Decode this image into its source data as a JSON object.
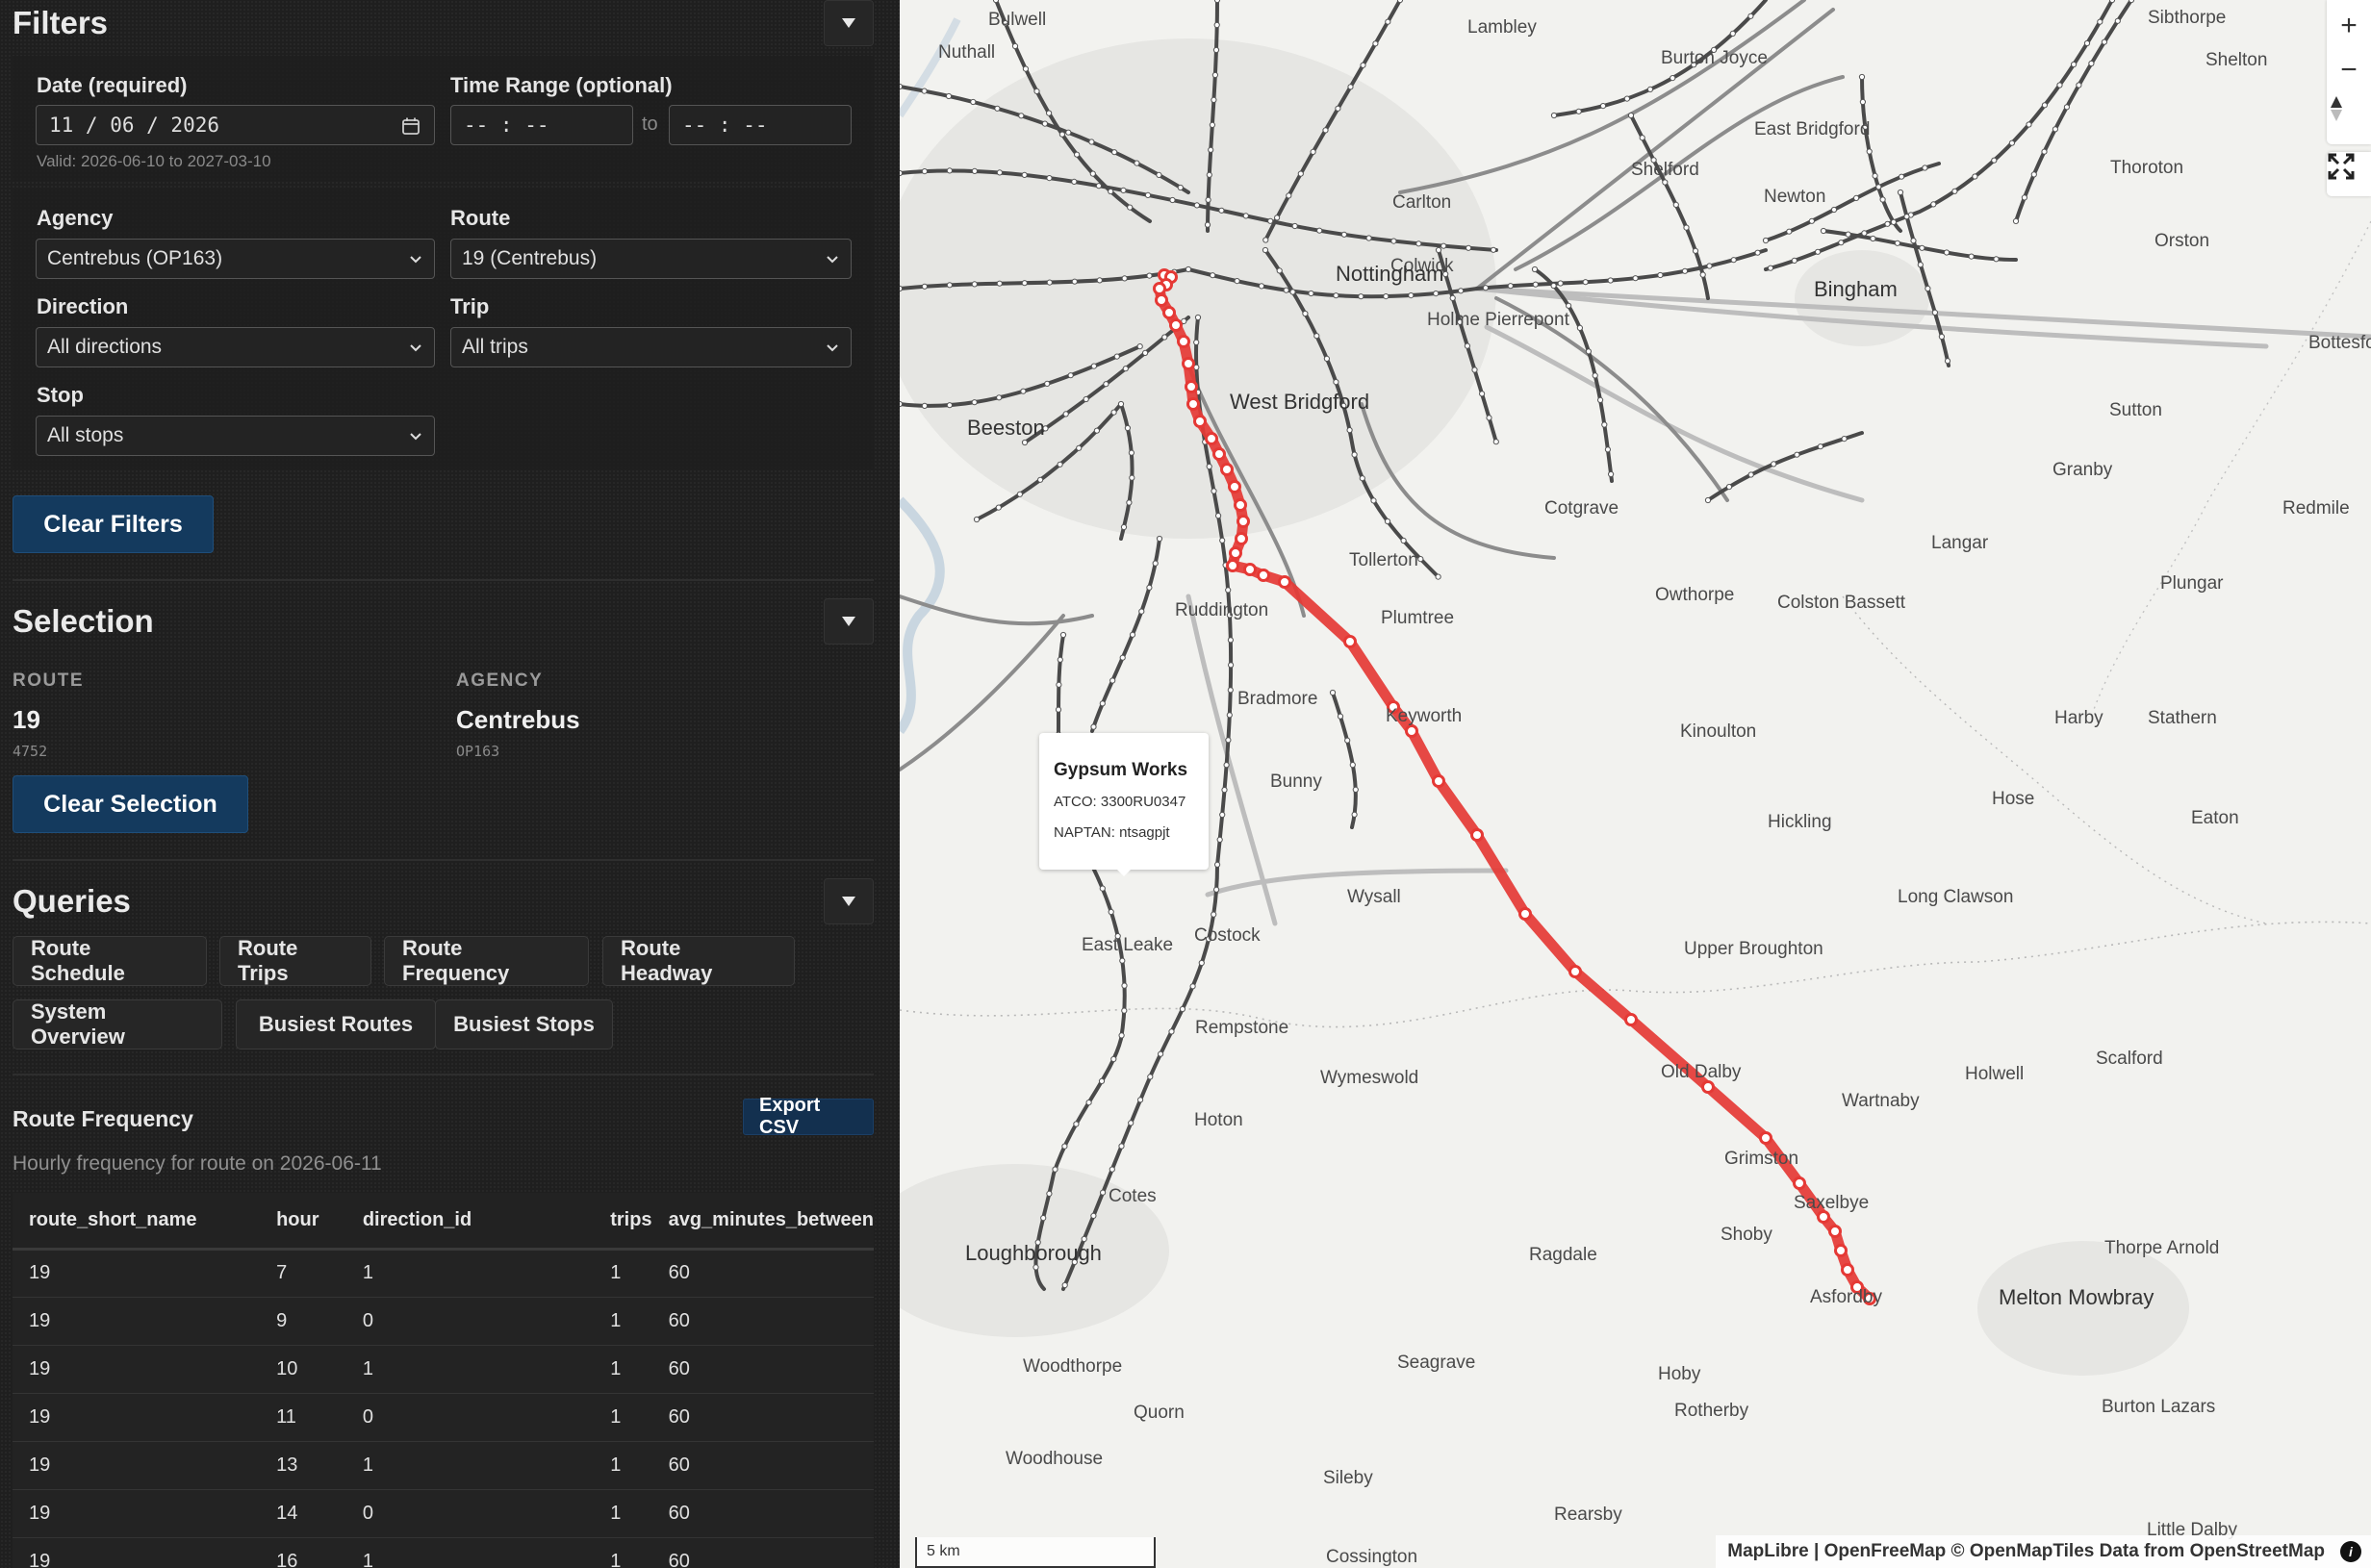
{
  "filters": {
    "title": "Filters",
    "date_label": "Date (required)",
    "date_value": "11 / 06 / 2026",
    "date_hint": "Valid: 2026-06-10 to 2027-03-10",
    "time_label": "Time Range (optional)",
    "time_from": "-- : --",
    "time_to": "-- : --",
    "time_sep": "to",
    "agency_label": "Agency",
    "agency_value": "Centrebus (OP163)",
    "route_label": "Route",
    "route_value": "19 (Centrebus)",
    "direction_label": "Direction",
    "direction_value": "All directions",
    "trip_label": "Trip",
    "trip_value": "All trips",
    "stop_label": "Stop",
    "stop_value": "All stops",
    "clear_label": "Clear Filters"
  },
  "selection": {
    "title": "Selection",
    "route_label": "ROUTE",
    "route_value": "19",
    "route_id": "4752",
    "agency_label": "AGENCY",
    "agency_value": "Centrebus",
    "agency_id": "OP163",
    "clear_label": "Clear Selection"
  },
  "queries": {
    "title": "Queries",
    "buttons": [
      "Route Schedule",
      "Route Trips",
      "Route Frequency",
      "Route Headway",
      "System Overview",
      "Busiest Routes",
      "Busiest Stops"
    ]
  },
  "result": {
    "title": "Route Frequency",
    "subtitle": "Hourly frequency for route on 2026-06-11",
    "export_label": "Export CSV",
    "columns": [
      "route_short_name",
      "hour",
      "direction_id",
      "trips",
      "avg_minutes_between"
    ],
    "rows": [
      [
        "19",
        "7",
        "1",
        "1",
        "60"
      ],
      [
        "19",
        "9",
        "0",
        "1",
        "60"
      ],
      [
        "19",
        "10",
        "1",
        "1",
        "60"
      ],
      [
        "19",
        "11",
        "0",
        "1",
        "60"
      ],
      [
        "19",
        "13",
        "1",
        "1",
        "60"
      ],
      [
        "19",
        "14",
        "0",
        "1",
        "60"
      ],
      [
        "19",
        "16",
        "1",
        "1",
        "60"
      ]
    ]
  },
  "map": {
    "popup": {
      "title": "Gypsum Works",
      "atco": "ATCO: 3300RU0347",
      "naptan": "NAPTAN: ntsagpjt"
    },
    "scale": "5 km",
    "attribution": "MapLibre | OpenFreeMap © OpenMapTiles Data from OpenStreetMap",
    "info": "i",
    "zoom_in": "+",
    "zoom_out": "−",
    "route_color": "#e53935",
    "places": [
      {
        "name": "Bulwell"
      },
      {
        "name": "Nuthall"
      },
      {
        "name": "Lambley"
      },
      {
        "name": "Burton Joyce"
      },
      {
        "name": "Sibthorpe"
      },
      {
        "name": "Shelton"
      },
      {
        "name": "East Bridgford"
      },
      {
        "name": "Shelford"
      },
      {
        "name": "Newton"
      },
      {
        "name": "Thoroton"
      },
      {
        "name": "Carlton"
      },
      {
        "name": "Colwick"
      },
      {
        "name": "Nottingham"
      },
      {
        "name": "Orston"
      },
      {
        "name": "Bingham"
      },
      {
        "name": "Holme Pierrepont"
      },
      {
        "name": "Bottesford"
      },
      {
        "name": "Beeston"
      },
      {
        "name": "West Bridgford"
      },
      {
        "name": "Sutton"
      },
      {
        "name": "Granby"
      },
      {
        "name": "Redmile"
      },
      {
        "name": "Cotgrave"
      },
      {
        "name": "Langar"
      },
      {
        "name": "Tollerton"
      },
      {
        "name": "Plungar"
      },
      {
        "name": "Owthorpe"
      },
      {
        "name": "Colston Bassett"
      },
      {
        "name": "Ruddington"
      },
      {
        "name": "Plumtree"
      },
      {
        "name": "Bradmore"
      },
      {
        "name": "Keyworth"
      },
      {
        "name": "Kinoulton"
      },
      {
        "name": "Harby"
      },
      {
        "name": "Stathern"
      },
      {
        "name": "Bunny"
      },
      {
        "name": "Hose"
      },
      {
        "name": "Eaton"
      },
      {
        "name": "Hickling"
      },
      {
        "name": "Wysall"
      },
      {
        "name": "Long Clawson"
      },
      {
        "name": "Costock"
      },
      {
        "name": "East Leake"
      },
      {
        "name": "Upper Broughton"
      },
      {
        "name": "Rempstone"
      },
      {
        "name": "Scalford"
      },
      {
        "name": "Old Dalby"
      },
      {
        "name": "Holwell"
      },
      {
        "name": "Wymeswold"
      },
      {
        "name": "Wartnaby"
      },
      {
        "name": "Hoton"
      },
      {
        "name": "Grimston"
      },
      {
        "name": "Cotes"
      },
      {
        "name": "Saxelbye"
      },
      {
        "name": "Shoby"
      },
      {
        "name": "Thorpe Arnold"
      },
      {
        "name": "Loughborough"
      },
      {
        "name": "Ragdale"
      },
      {
        "name": "Asfordby"
      },
      {
        "name": "Melton Mowbray"
      },
      {
        "name": "Woodthorpe"
      },
      {
        "name": "Seagrave"
      },
      {
        "name": "Hoby"
      },
      {
        "name": "Quorn"
      },
      {
        "name": "Rotherby"
      },
      {
        "name": "Burton Lazars"
      },
      {
        "name": "Woodhouse"
      },
      {
        "name": "Sileby"
      },
      {
        "name": "Rearsby"
      },
      {
        "name": "Cossington"
      },
      {
        "name": "Little Dalby"
      }
    ]
  }
}
